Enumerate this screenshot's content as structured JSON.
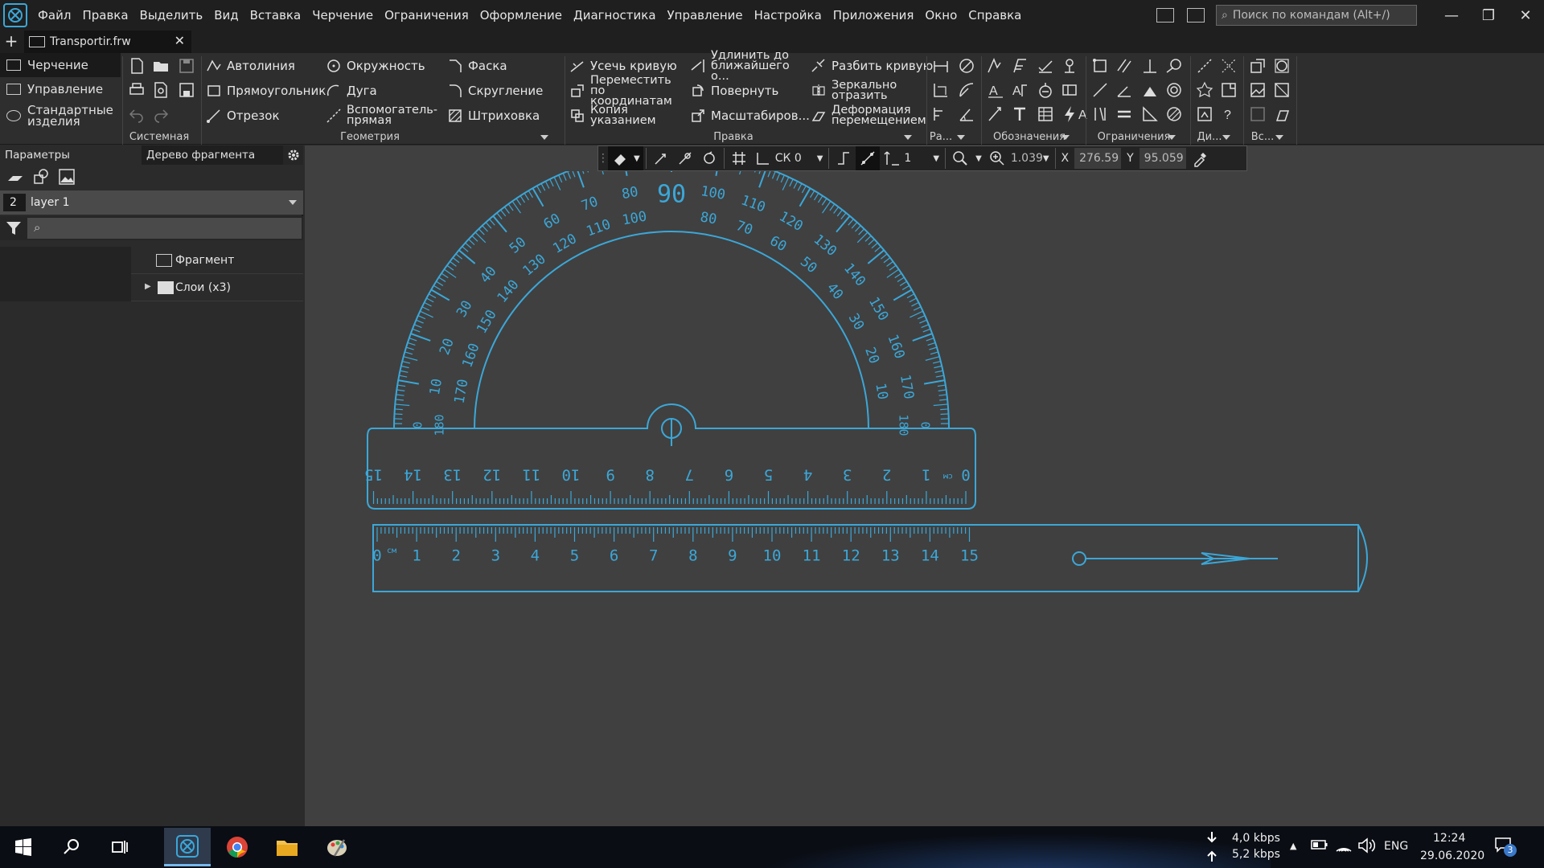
{
  "menu": {
    "items": [
      "Файл",
      "Правка",
      "Выделить",
      "Вид",
      "Вставка",
      "Черчение",
      "Ограничения",
      "Оформление",
      "Диагностика",
      "Управление",
      "Настройка",
      "Приложения",
      "Окно",
      "Справка"
    ],
    "search_placeholder": "Поиск по командам (Alt+/)"
  },
  "tabs": {
    "document": "Transportir.frw"
  },
  "ribbon": {
    "modes": [
      "Черчение",
      "Управление",
      "Стандартные изделия"
    ],
    "groups": {
      "system": "Системная",
      "geometry": "Геометрия",
      "edit": "Правка",
      "ra": "Ра...",
      "annotations": "Обозначения",
      "constraints": "Ограничения",
      "di": "Ди...",
      "vs": "Вс..."
    },
    "geometry_cmds": [
      "Автолиния",
      "Прямоугольник",
      "Отрезок",
      "Окружность",
      "Дуга",
      "Вспомогатель- прямая",
      "Фаска",
      "Скругление",
      "Штриховка"
    ],
    "edit_cmds": [
      "Усечь кривую",
      "Переместить по координатам",
      "Копия указанием",
      "Удлинить до ближайшего о...",
      "Повернуть",
      "Масштабиров...",
      "Разбить кривую",
      "Зеркально отразить",
      "Деформация перемещением"
    ]
  },
  "left_panel": {
    "tab_params": "Параметры",
    "tab_tree": "Дерево фрагмента",
    "layer_number": "2",
    "layer_name": "layer 1",
    "tree_items": [
      "Фрагмент",
      "Слои (x3)"
    ]
  },
  "cursor_toolbar": {
    "cs": "СК 0",
    "step": "1",
    "zoom": "1.039",
    "x_label": "X",
    "x_value": "276.59",
    "y_label": "Y",
    "y_value": "95.059"
  },
  "drawing": {
    "color": "#3ba7d8",
    "protractor_center_label": "90",
    "outer_labels": [
      "10",
      "20",
      "30",
      "40",
      "50",
      "60",
      "70",
      "80",
      "100",
      "110",
      "120",
      "130",
      "140",
      "150",
      "160",
      "170"
    ],
    "inner_labels": [
      "170",
      "160",
      "150",
      "140",
      "130",
      "120",
      "110",
      "100",
      "80",
      "70",
      "60",
      "50",
      "40",
      "30",
      "20",
      "10"
    ],
    "end_labels_outer": [
      "0",
      "0"
    ],
    "end_labels_inner": [
      "180",
      "180"
    ],
    "ruler_labels": [
      "0",
      "1",
      "2",
      "3",
      "4",
      "5",
      "6",
      "7",
      "8",
      "9",
      "10",
      "11",
      "12",
      "13",
      "14",
      "15"
    ],
    "unit": "см"
  },
  "taskbar": {
    "net_down": "4,0 kbps",
    "net_up": "5,2 kbps",
    "lang": "ENG",
    "time": "12:24",
    "date": "29.06.2020",
    "notifications": "3"
  }
}
